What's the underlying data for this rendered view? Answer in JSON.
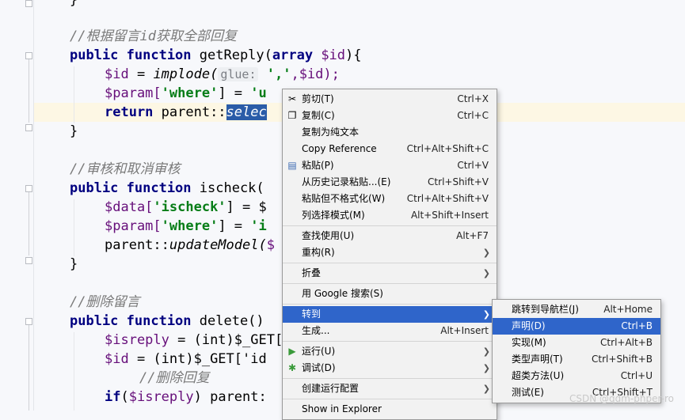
{
  "code": {
    "lines": {
      "l0": "}",
      "c1": "//根据留言id获取全部回复",
      "l2_kw": "public function",
      "l2_fn": " getReply(",
      "l2_kw2": "array",
      "l2_var": " $id",
      "l2_end": "){",
      "l3_var": "$id",
      "l3_eq": " = ",
      "l3_fn": "implode(",
      "l3_hint": "glue:",
      "l3_str": "','",
      "l3_rest": ",$id);",
      "l4_var": "$param[",
      "l4_str": "'where'",
      "l4_eq": "] = ",
      "l4_str2": "'u",
      "l5_kw": "return",
      "l5_rest": " parent::",
      "l5_sel": "selec",
      "l6": "}",
      "c7": "//审核和取消审核",
      "l8_kw": "public function",
      "l8_fn": " ischeck(",
      "l9_var": "$data[",
      "l9_str": "'ischeck'",
      "l9_eq": "] = $",
      "l10_var": "$param[",
      "l10_str": "'where'",
      "l10_eq": "] = ",
      "l10_str2": "'i",
      "l11_rest": "parent::",
      "l11_fn": "updateModel(",
      "l11_tail": "$",
      "l12": "}",
      "c13": "//删除留言",
      "l14_kw": "public function",
      "l14_fn": " delete()",
      "l15_var": "$isreply",
      "l15_rest": " = (int)$_GET[",
      "l16_var": "$id",
      "l16_rest": " = (int)$_GET['id",
      "c17": "//删除回复",
      "l18_kw": "if",
      "l18_rest": "(",
      "l18_var": "$isreply",
      "l18_rest2": ") parent:"
    }
  },
  "context_menu": {
    "items": [
      {
        "label": "剪切(T)",
        "shortcut": "Ctrl+X",
        "icon": "scissors-icon"
      },
      {
        "label": "复制(C)",
        "shortcut": "Ctrl+C",
        "icon": "copy-icon"
      },
      {
        "label": "复制为纯文本",
        "shortcut": ""
      },
      {
        "label": "Copy Reference",
        "shortcut": "Ctrl+Alt+Shift+C"
      },
      {
        "label": "粘贴(P)",
        "shortcut": "Ctrl+V",
        "icon": "paste-icon"
      },
      {
        "label": "从历史记录粘贴...(E)",
        "shortcut": "Ctrl+Shift+V"
      },
      {
        "label": "粘贴但不格式化(W)",
        "shortcut": "Ctrl+Alt+Shift+V"
      },
      {
        "label": "列选择模式(M)",
        "shortcut": "Alt+Shift+Insert"
      },
      {
        "label": "查找使用(U)",
        "shortcut": "Alt+F7"
      },
      {
        "label": "重构(R)",
        "shortcut": ""
      },
      {
        "label": "折叠",
        "shortcut": ""
      },
      {
        "label": "用 Google 搜索(S)",
        "shortcut": ""
      },
      {
        "label": "转到",
        "shortcut": ""
      },
      {
        "label": "生成...",
        "shortcut": "Alt+Insert"
      },
      {
        "label": "运行(U)",
        "shortcut": "",
        "icon": "run-icon"
      },
      {
        "label": "调试(D)",
        "shortcut": "",
        "icon": "debug-icon"
      },
      {
        "label": "创建运行配置",
        "shortcut": ""
      },
      {
        "label": "Show in Explorer",
        "shortcut": ""
      }
    ]
  },
  "submenu": {
    "items": [
      {
        "label": "跳转到导航栏(J)",
        "shortcut": "Alt+Home"
      },
      {
        "label": "声明(D)",
        "shortcut": "Ctrl+B"
      },
      {
        "label": "实现(M)",
        "shortcut": "Ctrl+Alt+B"
      },
      {
        "label": "类型声明(T)",
        "shortcut": "Ctrl+Shift+B"
      },
      {
        "label": "超类方法(U)",
        "shortcut": "Ctrl+U"
      },
      {
        "label": "测试(E)",
        "shortcut": "Ctrl+Shift+T"
      }
    ]
  },
  "watermark": "CSDN @qdm-phper-ro",
  "colors": {
    "accent": "#2f65ca",
    "keyword": "#000080",
    "string": "#067d17",
    "variable": "#660e7a"
  }
}
